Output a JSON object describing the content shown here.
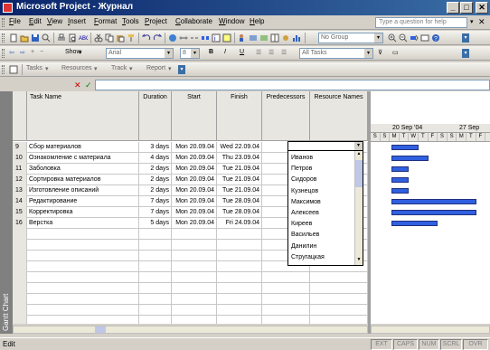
{
  "window": {
    "title": "Microsoft Project - Журнал"
  },
  "menu": [
    "File",
    "Edit",
    "View",
    "Insert",
    "Format",
    "Tools",
    "Project",
    "Collaborate",
    "Window",
    "Help"
  ],
  "help_box": {
    "placeholder": "Type a question for help"
  },
  "toolbar1": {
    "group_combo": "No Group"
  },
  "toolbar2": {
    "show_label": "Show",
    "font_combo": "Arial",
    "size_combo": "8",
    "bold": "B",
    "italic": "I",
    "underline": "U",
    "filter_combo": "All Tasks"
  },
  "toolbar3": {
    "tasks": "Tasks",
    "resources": "Resources",
    "track": "Track",
    "report": "Report"
  },
  "columns": {
    "name": "Task Name",
    "duration": "Duration",
    "start": "Start",
    "finish": "Finish",
    "predecessors": "Predecessors",
    "resources": "Resource Names"
  },
  "tasks": [
    {
      "id": "9",
      "name": "Сбор материалов",
      "duration": "3 days",
      "start": "Mon 20.09.04",
      "finish": "Wed 22.09.04"
    },
    {
      "id": "10",
      "name": "Ознакомление с материала",
      "duration": "4 days",
      "start": "Mon 20.09.04",
      "finish": "Thu 23.09.04"
    },
    {
      "id": "11",
      "name": "Заболовка",
      "duration": "2 days",
      "start": "Mon 20.09.04",
      "finish": "Tue 21.09.04"
    },
    {
      "id": "12",
      "name": "Сортировка материалов",
      "duration": "2 days",
      "start": "Mon 20.09.04",
      "finish": "Tue 21.09.04"
    },
    {
      "id": "13",
      "name": "Изготовление описаний",
      "duration": "2 days",
      "start": "Mon 20.09.04",
      "finish": "Tue 21.09.04"
    },
    {
      "id": "14",
      "name": "Редактирование",
      "duration": "7 days",
      "start": "Mon 20.09.04",
      "finish": "Tue 28.09.04"
    },
    {
      "id": "15",
      "name": "Корректировка",
      "duration": "7 days",
      "start": "Mon 20.09.04",
      "finish": "Tue 28.09.04"
    },
    {
      "id": "16",
      "name": "Верстка",
      "duration": "5 days",
      "start": "Mon 20.09.04",
      "finish": "Fri 24.09.04"
    }
  ],
  "resource_options": [
    "Иванов",
    "Петров",
    "Сидоров",
    "Кузнецов",
    "Максимов",
    "Алексеев",
    "Киреев",
    "Васильев",
    "Данилин",
    "Стругацкая"
  ],
  "gantt": {
    "week1": "20 Sep '04",
    "week2": "27 Sep",
    "days": [
      "S",
      "S",
      "M",
      "T",
      "W",
      "T",
      "F",
      "S",
      "S",
      "M",
      "T",
      "F"
    ],
    "bar_color": "#3060e0"
  },
  "viewbar": {
    "label": "Gantt Chart"
  },
  "status": {
    "mode": "Edit",
    "indicators": [
      "EXT",
      "CAPS",
      "NUM",
      "SCRL",
      "OVR"
    ]
  }
}
